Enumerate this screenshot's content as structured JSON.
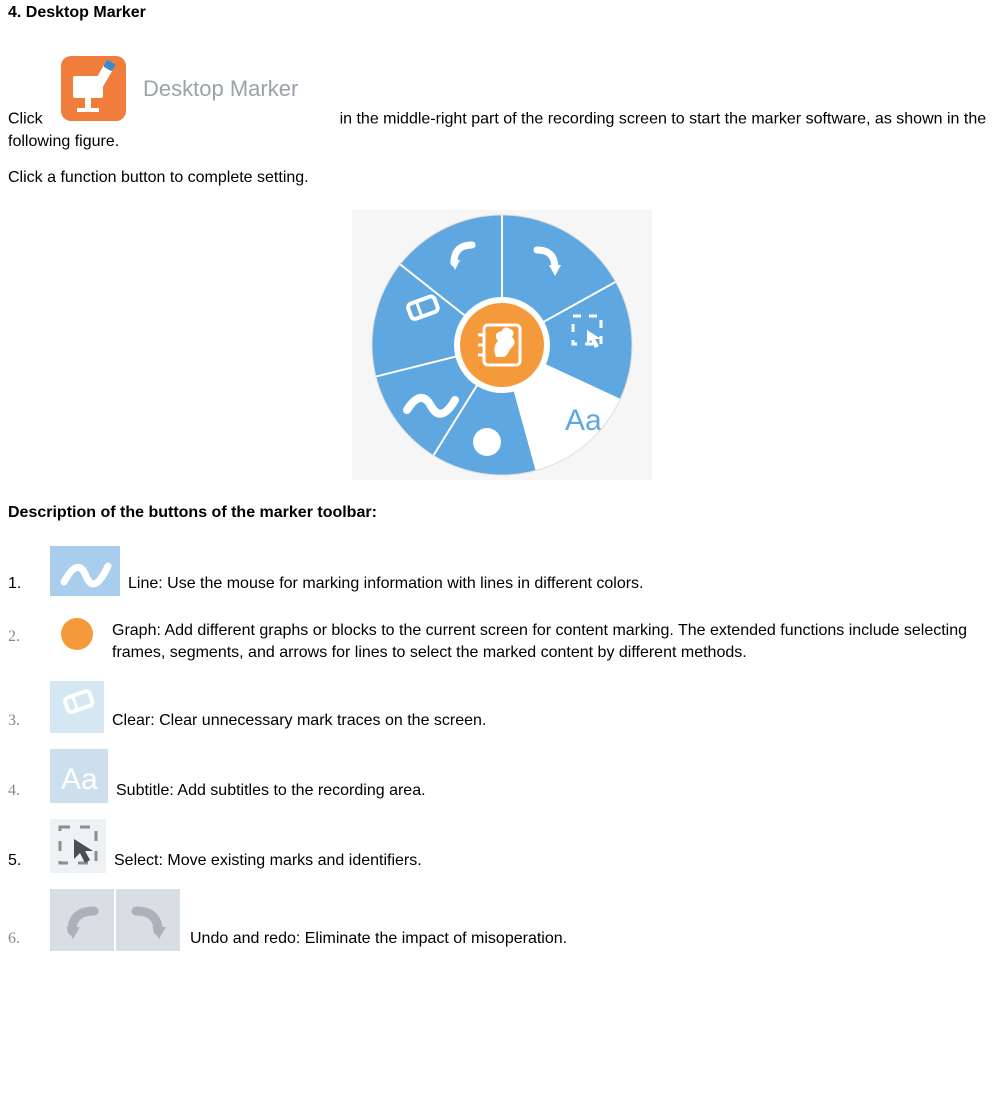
{
  "heading": "4. Desktop Marker",
  "desktop_marker_label": "Desktop Marker",
  "para1_prefix": "Click",
  "para1_suffix": " in the middle-right part of the recording screen to start the marker software, as shown in the following figure.",
  "para2": "Click a function button to complete setting.",
  "description_heading": "Description of the buttons of the marker toolbar:",
  "items": [
    {
      "num": "1.",
      "label": "Line",
      "desc": "Use the mouse for marking information with lines in different colors."
    },
    {
      "num": "2.",
      "label": "Graph",
      "desc": "Add different graphs or blocks to the current screen for content marking. The extended functions include selecting frames, segments, and arrows for lines to select the marked content by different methods."
    },
    {
      "num": "3.",
      "label": "Clear",
      "desc": "Clear unnecessary mark traces on the screen."
    },
    {
      "num": "4.",
      "label": "Subtitle",
      "desc": "Add subtitles to the recording area."
    },
    {
      "num": "5.",
      "label": "Select",
      "desc": "Move existing marks and identifiers."
    },
    {
      "num": "6.",
      "label": "Undo and redo",
      "desc": "Eliminate the impact of misoperation."
    }
  ],
  "radial_text_aa": "Aa"
}
